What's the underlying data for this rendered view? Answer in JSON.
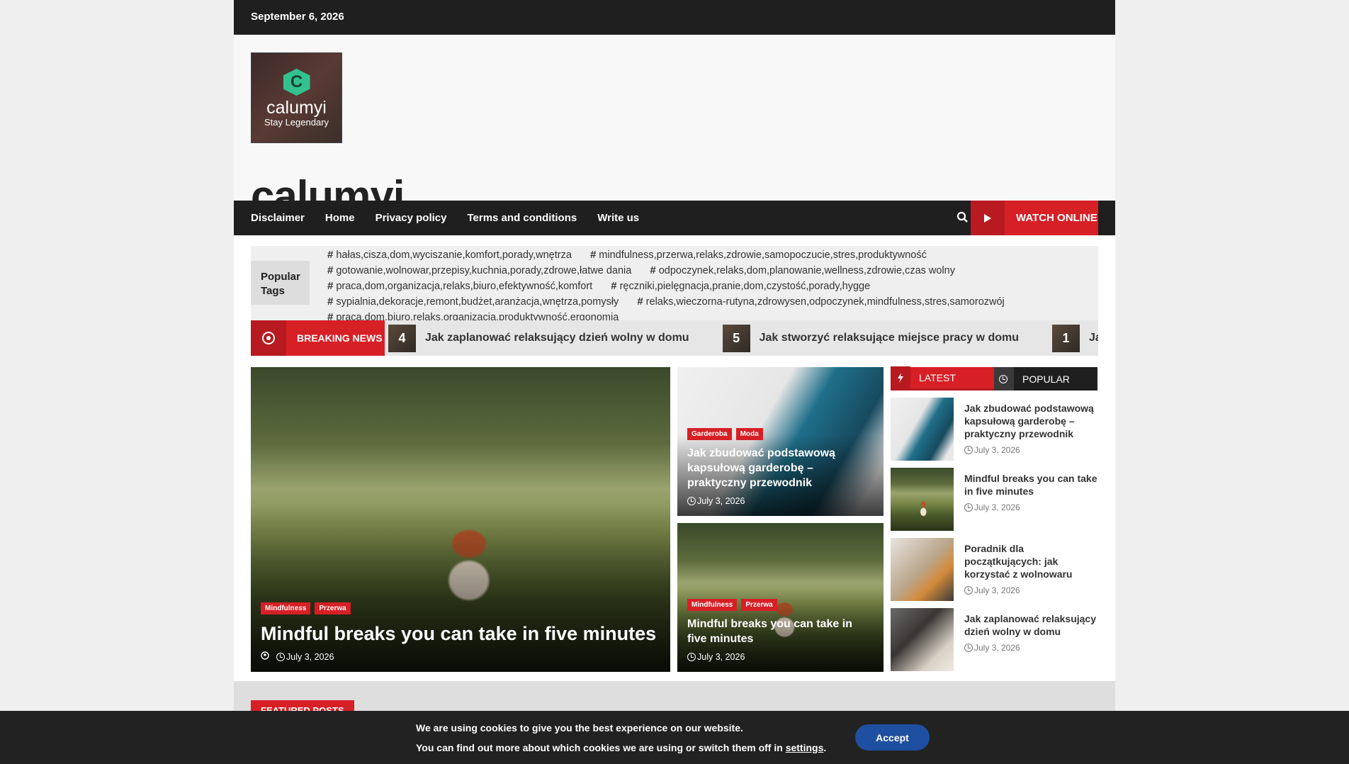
{
  "topbar": {
    "date": "September 6, 2026"
  },
  "logo": {
    "letter": "C",
    "name": "calumyi",
    "tagline": "Stay Legendary"
  },
  "site": {
    "title": "calumyi"
  },
  "nav": {
    "items": [
      "Disclaimer",
      "Home",
      "Privacy policy",
      "Terms and conditions",
      "Write us"
    ],
    "watch_label": "WATCH ONLINE"
  },
  "popular_tags": {
    "label_line1": "Popular",
    "label_line2": "Tags",
    "tags": [
      "hałas,cisza,dom,wyciszanie,komfort,porady,wnętrza",
      "mindfulness,przerwa,relaks,zdrowie,samopoczucie,stres,produktywność",
      "gotowanie,wolnowar,przepisy,kuchnia,porady,zdrowe,łatwe dania",
      "odpoczynek,relaks,dom,planowanie,wellness,zdrowie,czas wolny",
      "praca,dom,organizacja,relaks,biuro,efektywność,komfort",
      "ręczniki,pielęgnacja,pranie,dom,czystość,porady,hygge",
      "sypialnia,dekoracje,remont,budżet,aranżacja,wnętrza,pomysły",
      "relaks,wieczorna-rutyna,zdrowysen,odpoczynek,mindfulness,stres,samorozwój",
      "praca,dom,biuro,relaks,organizacja,produktywność,ergonomia"
    ]
  },
  "breaking": {
    "label": "BREAKING NEWS",
    "items": [
      {
        "num": "4",
        "title": "Jak zaplanować relaksujący dzień wolny w domu"
      },
      {
        "num": "5",
        "title": "Jak stworzyć relaksujące miejsce pracy w domu"
      },
      {
        "num": "1",
        "title": "Jak zbudo"
      }
    ]
  },
  "hero": {
    "cats": [
      "Mindfulness",
      "Przerwa"
    ],
    "title": "Mindful breaks you can take in five minutes",
    "date": "July 3, 2026"
  },
  "mid": [
    {
      "cats": [
        "Garderoba",
        "Moda"
      ],
      "title": "Jak zbudować podstawową kapsułową garderobę – praktyczny przewodnik",
      "date": "July 3, 2026"
    },
    {
      "cats": [
        "Mindfulness",
        "Przerwa"
      ],
      "title": "Mindful breaks you can take in five minutes",
      "date": "July 3, 2026"
    }
  ],
  "sidebar": {
    "tab_latest": "LATEST",
    "tab_popular": "POPULAR",
    "posts": [
      {
        "title": "Jak zbudować podstawową kapsułową garderobę – praktyczny przewodnik",
        "date": "July 3, 2026"
      },
      {
        "title": "Mindful breaks you can take in five minutes",
        "date": "July 3, 2026"
      },
      {
        "title": "Poradnik dla początkujących: jak korzystać z wolnowaru",
        "date": "July 3, 2026"
      },
      {
        "title": "Jak zaplanować relaksujący dzień wolny w domu",
        "date": "July 3, 2026"
      }
    ]
  },
  "featured": {
    "label": "FEATURED POSTS"
  },
  "cookie": {
    "line1": "We are using cookies to give you the best experience on our website.",
    "line2_prefix": "You can find out more about which cookies we are using or switch them off in ",
    "settings_link": "settings",
    "line2_suffix": ".",
    "accept": "Accept"
  },
  "colors": {
    "accent": "#d71f26",
    "dark": "#1f1f1f",
    "accept_button": "#1f4fa0"
  }
}
